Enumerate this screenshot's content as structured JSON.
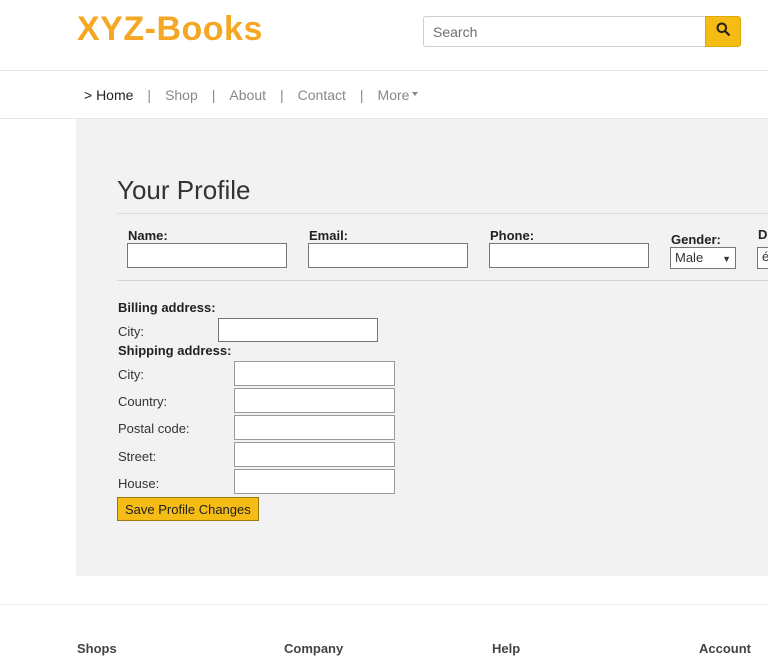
{
  "brand": "XYZ-Books",
  "search": {
    "placeholder": "Search"
  },
  "nav": {
    "home": "> Home",
    "shop": "Shop",
    "about": "About",
    "contact": "Contact",
    "more": "More",
    "separator": "|"
  },
  "profile": {
    "title": "Your Profile",
    "name_label": "Name:",
    "email_label": "Email:",
    "phone_label": "Phone:",
    "gender_label": "Gender:",
    "gender_value": "Male",
    "extra_label": "D",
    "extra_value": "é",
    "billing_heading": "Billing address:",
    "billing_city_label": "City:",
    "shipping_heading": "Shipping address:",
    "shipping_city_label": "City:",
    "shipping_country_label": "Country:",
    "shipping_postal_label": "Postal code:",
    "shipping_street_label": "Street:",
    "shipping_house_label": "House:",
    "save_label": "Save Profile Changes"
  },
  "footer": {
    "shops": "Shops",
    "company": "Company",
    "help": "Help",
    "account": "Account"
  },
  "colors": {
    "accent": "#f5bc16",
    "brand": "#f5a623",
    "panel": "#f2f2f2"
  }
}
